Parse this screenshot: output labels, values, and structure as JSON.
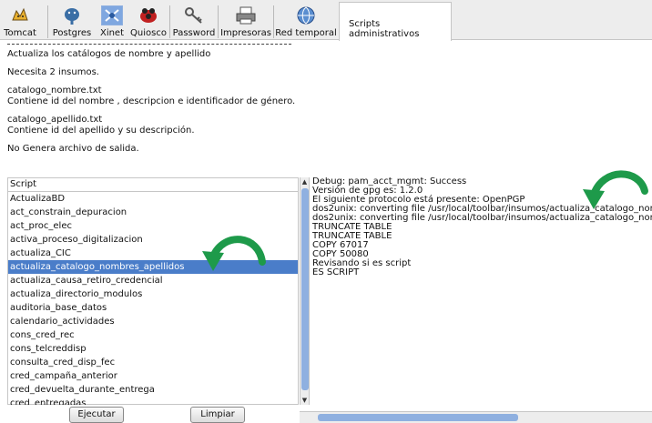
{
  "toolbar": {
    "tools": [
      {
        "label": "Tomcat",
        "icon": "tomcat-icon"
      },
      {
        "label": "Postgres",
        "icon": "postgres-elephant-icon"
      },
      {
        "label": "Xinet",
        "icon": "xinet-icon"
      },
      {
        "label": "Quiosco",
        "icon": "kiosk-icon"
      },
      {
        "label": "Password",
        "icon": "key-icon"
      },
      {
        "label": "Impresoras",
        "icon": "printer-icon"
      },
      {
        "label": "Red temporal",
        "icon": "network-globe-icon"
      }
    ],
    "active_tab": "Scripts administrativos",
    "selected_tool": "Xinet"
  },
  "description": {
    "lines": [
      "Actualiza los catálogos de nombre y apellido",
      "",
      "Necesita 2 insumos.",
      "",
      "catalogo_nombre.txt",
      "Contiene id del nombre  , descripcion e identificador de género.",
      "",
      "catalogo_apellido.txt",
      "Contiene id del apellido y su descripción.",
      "",
      "No Genera archivo de salida."
    ]
  },
  "script_list": {
    "header": "Script",
    "selected": "actualiza_catalogo_nombres_apellidos",
    "items": [
      "ActualizaBD",
      "act_constrain_depuracion",
      "act_proc_elec",
      "activa_proceso_digitalizacion",
      "actualiza_CIC",
      "actualiza_catalogo_nombres_apellidos",
      "actualiza_causa_retiro_credencial",
      "actualiza_directorio_modulos",
      "auditoria_base_datos",
      "calendario_actividades",
      "cons_cred_rec",
      "cons_telcreddisp",
      "consulta_cred_disp_fec",
      "cred_campaña_anterior",
      "cred_devuelta_durante_entrega",
      "cred_entregadas"
    ]
  },
  "output_log": {
    "lines": [
      "Debug: pam_acct_mgmt: Success",
      "Versión de gpg es: 1.2.0",
      "El siguiente protocolo está presente: OpenPGP",
      "dos2unix: converting file /usr/local/toolbar/insumos/actualiza_catalogo_nombr",
      "dos2unix: converting file /usr/local/toolbar/insumos/actualiza_catalogo_nombr",
      "TRUNCATE TABLE",
      "TRUNCATE TABLE",
      "COPY 67017",
      "COPY 50080",
      "Revisando si es script",
      "ES SCRIPT"
    ]
  },
  "buttons": {
    "run": "Ejecutar",
    "clear": "Limpiar"
  },
  "colors": {
    "selection": "#4a7dc9",
    "annotation_arrow": "#1e9a4a",
    "scroll_thumb": "#8fb0e0"
  }
}
